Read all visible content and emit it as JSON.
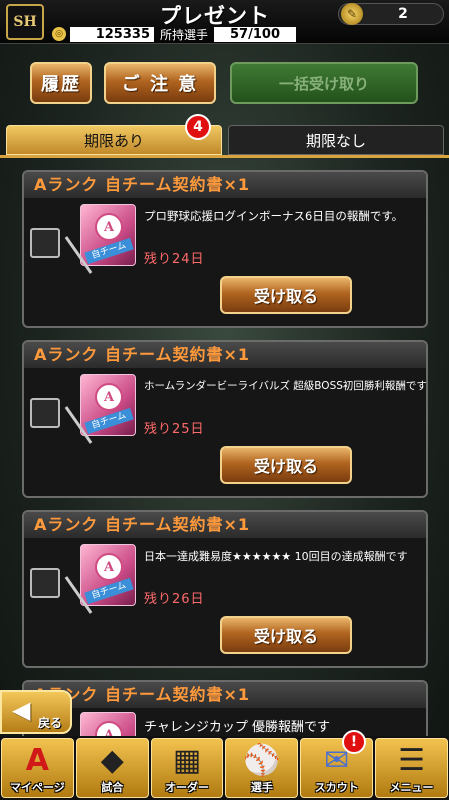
{
  "header": {
    "logo": "SH",
    "title": "プレゼント",
    "coins": "125335",
    "owned_label": "所持選手",
    "owned_value": "57/100",
    "tickets": "2"
  },
  "actions": {
    "history": "履歴",
    "caution": "ご 注 意",
    "receive_all": "一括受け取り"
  },
  "tabs": {
    "active": "期限あり",
    "active_badge": "4",
    "inactive": "期限なし"
  },
  "receive_label": "受け取る",
  "item_image_text": "自チーム",
  "items": [
    {
      "title": "Aランク 自チーム契約書×1",
      "desc": "プロ野球応援ログインボーナス6日目の報酬です。",
      "remain": "残り24日"
    },
    {
      "title": "Aランク 自チーム契約書×1",
      "desc": "ホームランダービーライバルズ 超級BOSS初回勝利報酬です。",
      "remain": "残り25日"
    },
    {
      "title": "Aランク 自チーム契約書×1",
      "desc": "日本一達成難易度★★★★★★ 10回目の達成報酬です",
      "remain": "残り26日"
    },
    {
      "title": "Aランク 自チーム契約書×1",
      "desc": "チャレンジカップ 優勝報酬です"
    }
  ],
  "back_label": "戻る",
  "nav": [
    {
      "label": "マイページ",
      "icon": "A"
    },
    {
      "label": "試合",
      "icon": "◆"
    },
    {
      "label": "オーダー",
      "icon": "▦"
    },
    {
      "label": "選手",
      "icon": "⚾"
    },
    {
      "label": "スカウト",
      "icon": "✉"
    },
    {
      "label": "メニュー",
      "icon": "☰"
    }
  ],
  "nav_badge": "!"
}
